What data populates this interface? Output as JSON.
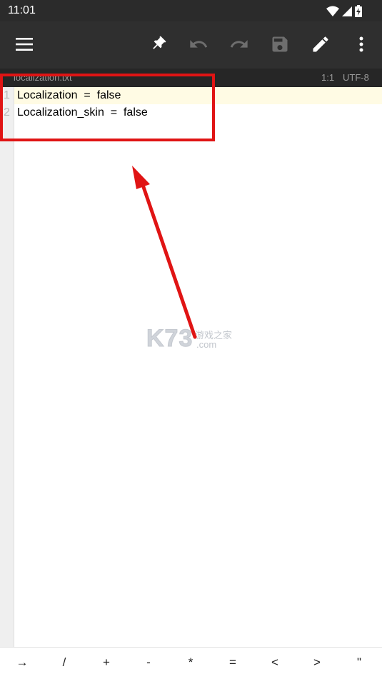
{
  "status_bar": {
    "time": "11:01",
    "icons": [
      "wifi-icon",
      "signal-icon",
      "battery-charging-icon"
    ]
  },
  "toolbar": {
    "buttons": [
      "menu-icon",
      "pin-icon",
      "undo-icon",
      "redo-icon",
      "save-icon",
      "edit-icon",
      "more-vert-icon"
    ]
  },
  "file_tab": {
    "name": "localization.txt",
    "cursor": "1:1",
    "encoding": "UTF-8"
  },
  "editor": {
    "lines": [
      {
        "num": "1",
        "text": "Localization  =  false"
      },
      {
        "num": "2",
        "text": "Localization_skin  =  false"
      }
    ]
  },
  "watermark": {
    "brand": "K73",
    "tagline": "游戏之家",
    "domain": ".com"
  },
  "symbol_bar": {
    "keys": [
      "→",
      "/",
      "+",
      "-",
      "*",
      "=",
      "<",
      ">",
      "\""
    ]
  },
  "colors": {
    "toolbar_bg": "#2f2f2f",
    "annotation_red": "#e01414",
    "current_line": "#fffbe4"
  }
}
